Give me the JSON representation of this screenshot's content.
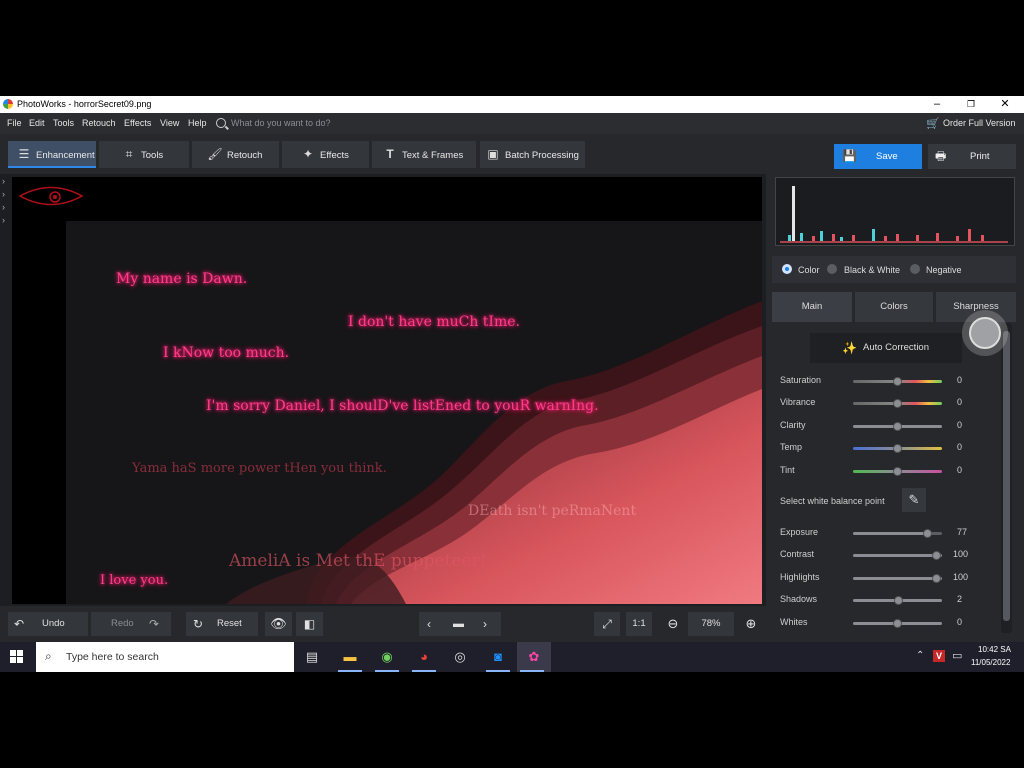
{
  "window": {
    "title": "PhotoWorks - horrorSecret09.png",
    "controls": [
      "–",
      "❐",
      "✕"
    ]
  },
  "menu": {
    "items": [
      "File",
      "Edit",
      "Tools",
      "Retouch",
      "Effects",
      "View",
      "Help"
    ],
    "search_placeholder": "What do you want to do?",
    "order_full_version": "Order Full Version"
  },
  "toolbar": {
    "tabs": [
      "Enhancement",
      "Tools",
      "Retouch",
      "Effects",
      "Text & Frames"
    ],
    "batch": "Batch Processing",
    "save": "Save",
    "print": "Print"
  },
  "photo_texts": [
    "My name is Dawn.",
    "I don't have muCh tIme.",
    "I kNow too much.",
    "I'm sorry Daniel, I shoulD've listEned to youR warnIng.",
    "Yama haS more power tHen you think.",
    "DEath isn't peRmaNent",
    "AmeliA is Met thE puppeteer!",
    "I love you."
  ],
  "bottom": {
    "undo": "Undo",
    "redo": "Redo",
    "reset": "Reset",
    "ratio": "1:1",
    "zoom": "78%"
  },
  "panel": {
    "modes": [
      "Color",
      "Black & White",
      "Negative"
    ],
    "selected_mode": "Color",
    "tabs": [
      "Main",
      "Colors",
      "Sharpness"
    ],
    "auto_correction": "Auto Correction",
    "white_balance": "Select white balance point",
    "sliders_top": [
      {
        "label": "Saturation",
        "value": "0"
      },
      {
        "label": "Vibrance",
        "value": "0"
      },
      {
        "label": "Clarity",
        "value": "0"
      },
      {
        "label": "Temp",
        "value": "0"
      },
      {
        "label": "Tint",
        "value": "0"
      }
    ],
    "sliders_bottom": [
      {
        "label": "Exposure",
        "value": "77"
      },
      {
        "label": "Contrast",
        "value": "100"
      },
      {
        "label": "Highlights",
        "value": "100"
      },
      {
        "label": "Shadows",
        "value": "2"
      },
      {
        "label": "Whites",
        "value": "0"
      }
    ]
  },
  "taskbar": {
    "search_placeholder": "Type here to search",
    "time": "10:42 SA",
    "date": "11/05/2022"
  },
  "colors": {
    "accent": "#1e7fe0",
    "neon_text": "#ff3d8d"
  }
}
